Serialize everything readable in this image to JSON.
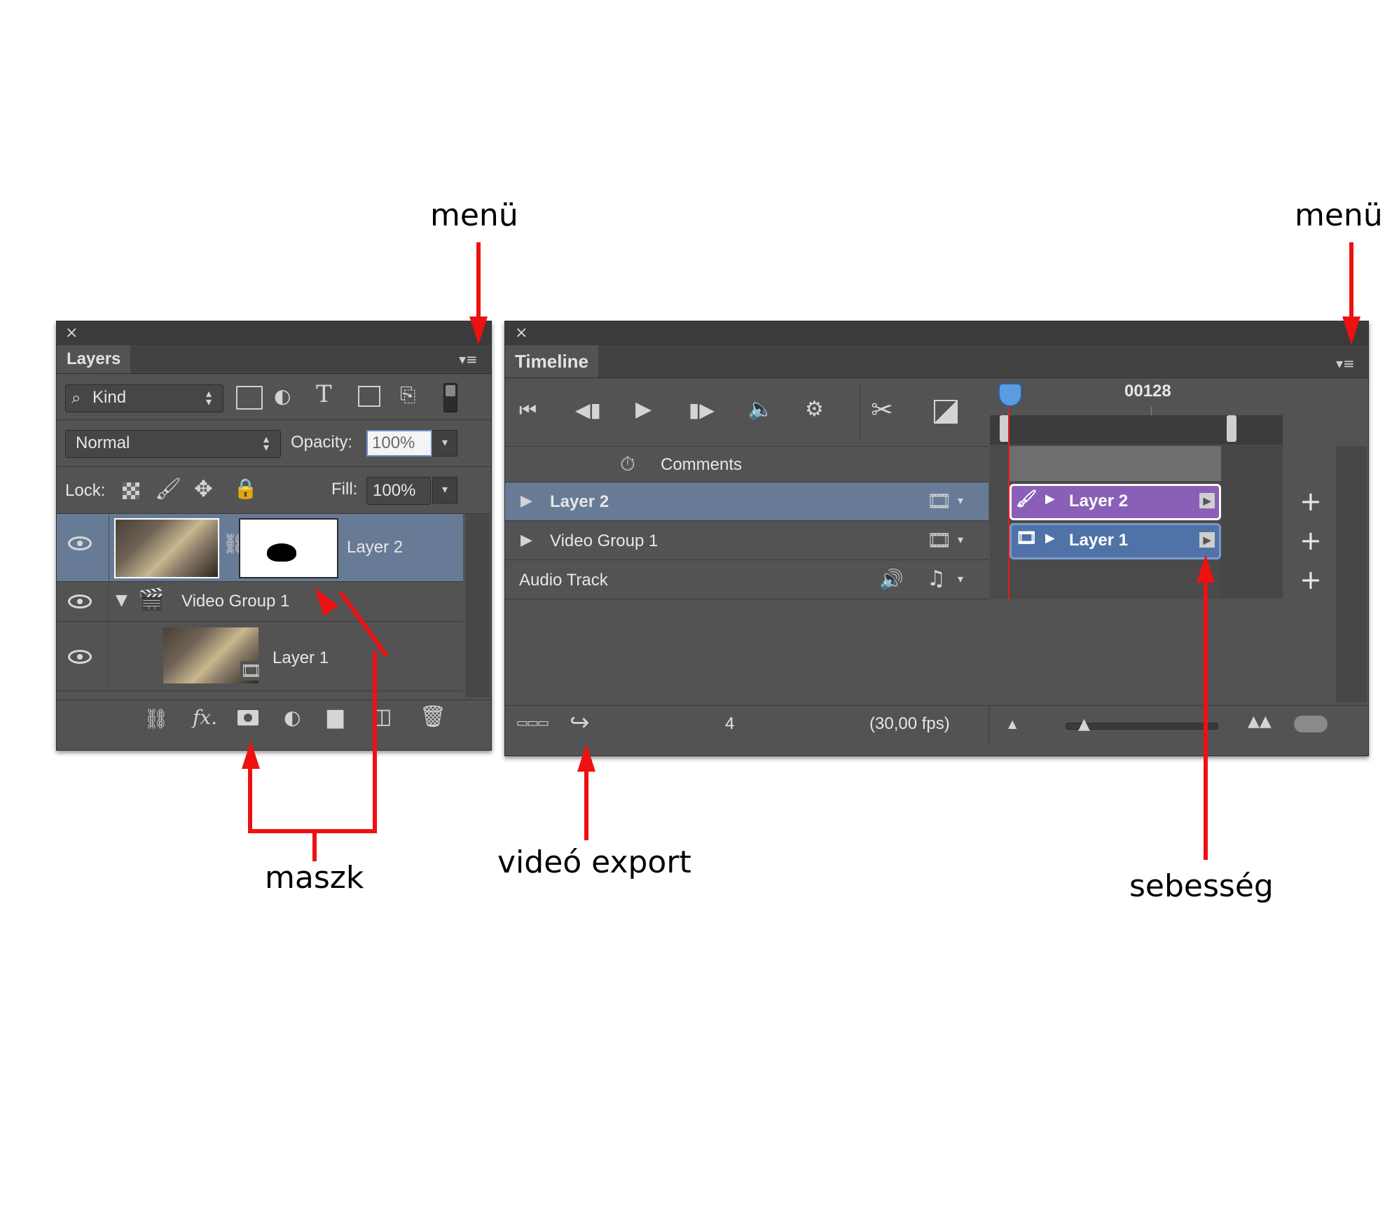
{
  "annotations": {
    "menu_left": "menü",
    "menu_right": "menü",
    "mask": "maszk",
    "video_export": "videó export",
    "speed": "sebesség"
  },
  "layers_panel": {
    "close": "×",
    "tab": "Layers",
    "filter_kind": "Kind",
    "blend_mode": "Normal",
    "opacity_label": "Opacity:",
    "opacity_value": "100%",
    "lock_label": "Lock:",
    "fill_label": "Fill:",
    "fill_value": "100%",
    "layers": [
      {
        "name": "Layer 2"
      },
      {
        "name": "Video Group 1"
      },
      {
        "name": "Layer 1"
      }
    ],
    "fx_label": "fx"
  },
  "timeline_panel": {
    "close": "×",
    "tab": "Timeline",
    "current_frame": "00128",
    "tracks": [
      {
        "name": "Comments"
      },
      {
        "name": "Layer 2",
        "clip": "Layer 2",
        "clip_color": "#8a5fb8"
      },
      {
        "name": "Video Group 1",
        "clip": "Layer 1",
        "clip_color": "#4f73a6"
      },
      {
        "name": "Audio Track"
      }
    ],
    "frame_number": "4",
    "fps": "(30,00 fps)"
  },
  "colors": {
    "panel_bg": "#535353",
    "selected_row": "#687b96",
    "annotation_red": "#ee1111"
  }
}
